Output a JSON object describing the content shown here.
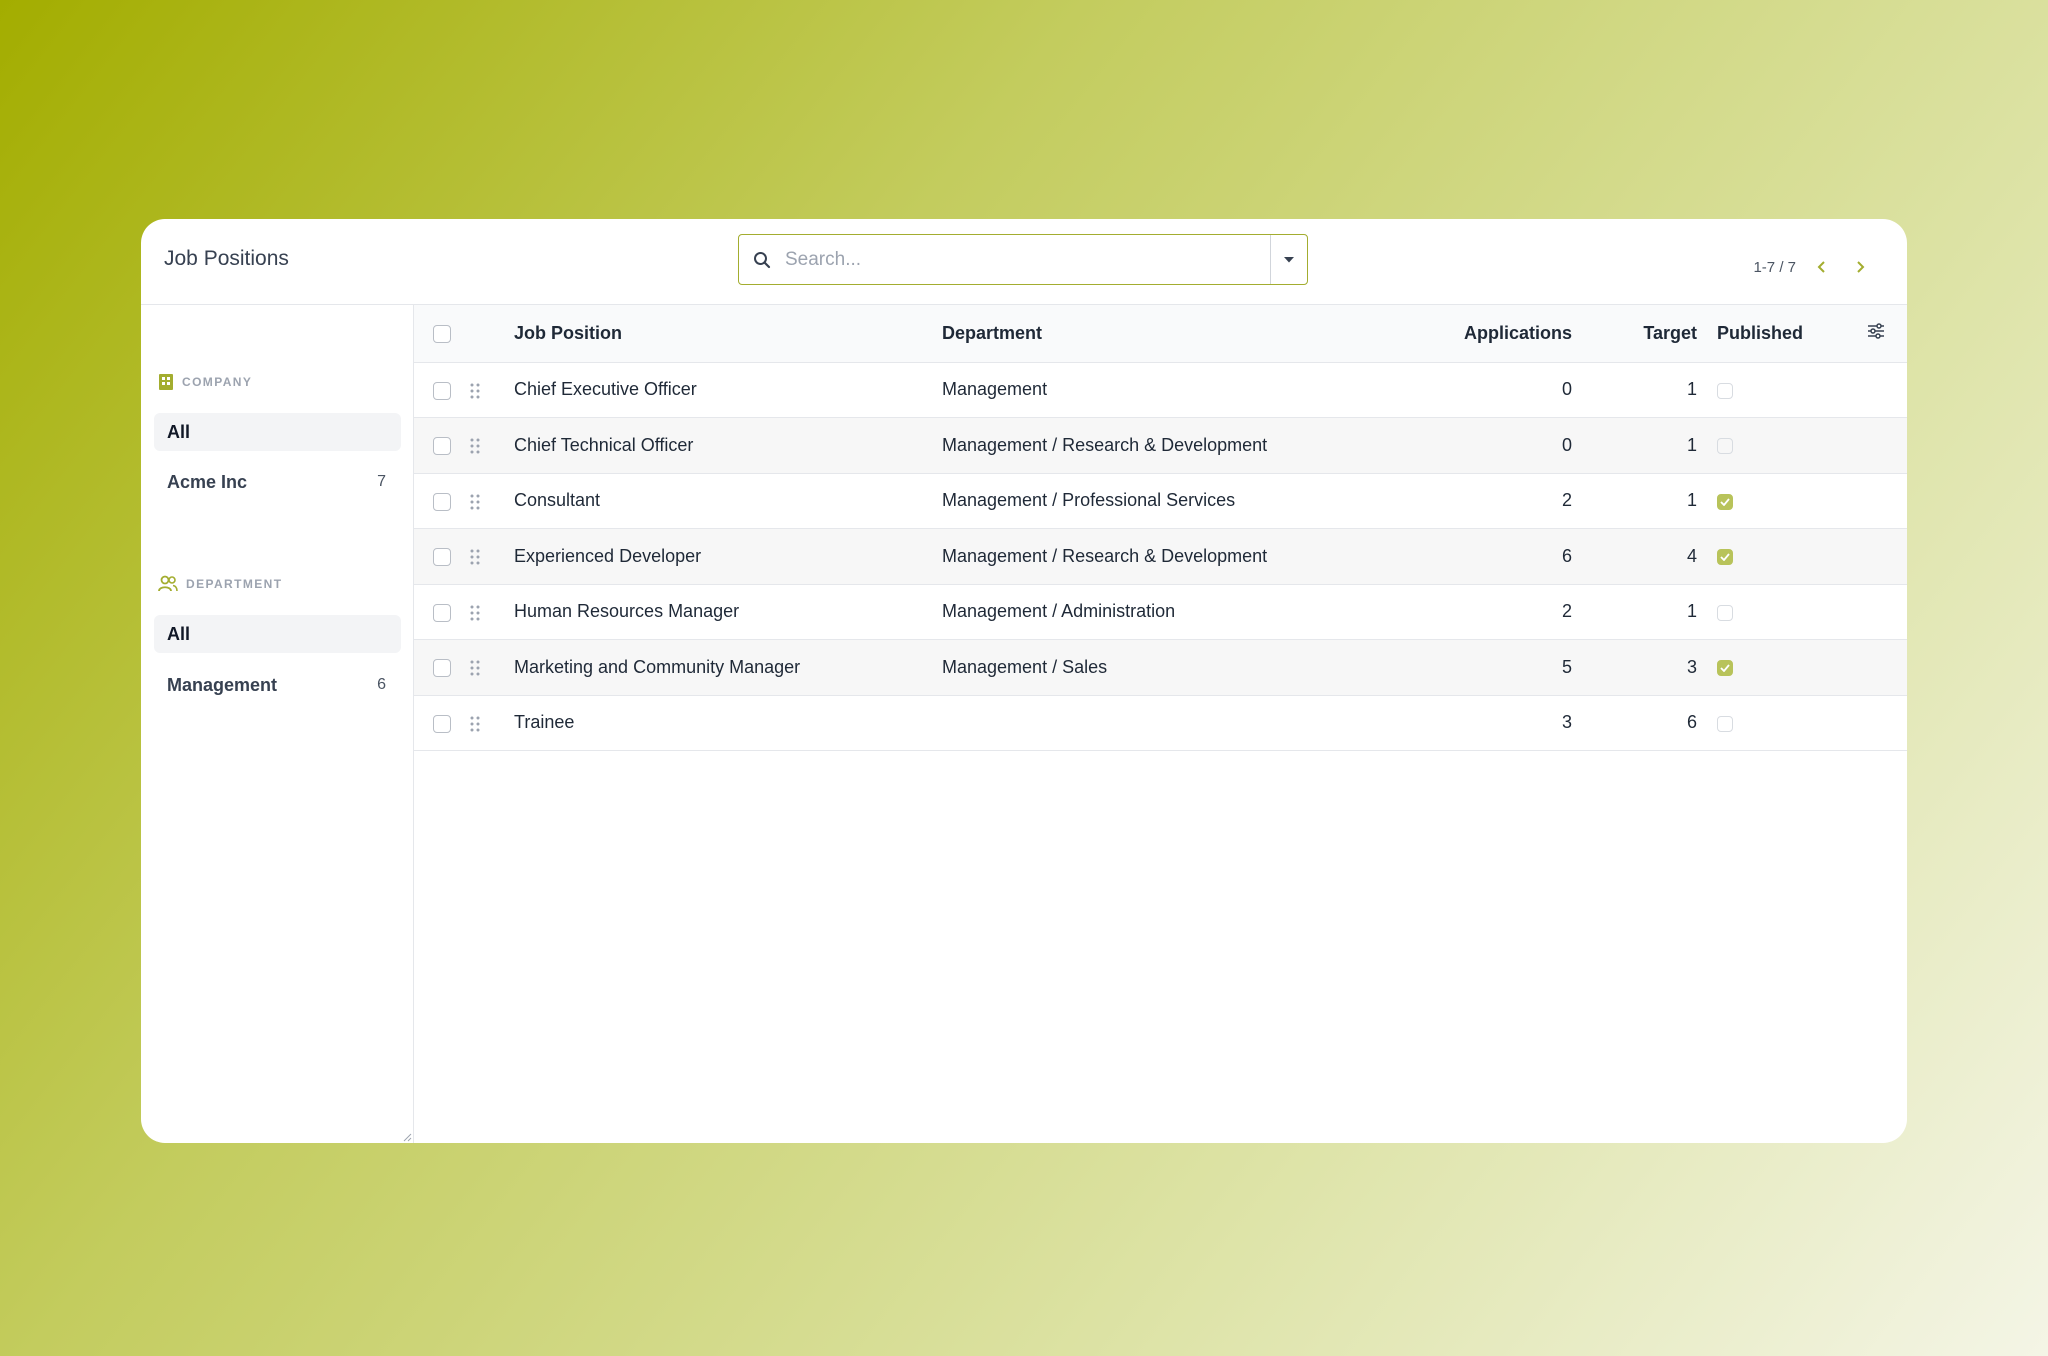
{
  "header": {
    "title": "Job Positions",
    "search_placeholder": "Search...",
    "pager": "1-7 / 7"
  },
  "sidebar": {
    "company": {
      "heading": "COMPANY",
      "items": [
        {
          "label": "All",
          "count": ""
        },
        {
          "label": "Acme Inc",
          "count": "7"
        }
      ]
    },
    "department": {
      "heading": "DEPARTMENT",
      "items": [
        {
          "label": "All",
          "count": ""
        },
        {
          "label": "Management",
          "count": "6"
        }
      ]
    }
  },
  "table": {
    "columns": {
      "position": "Job Position",
      "department": "Department",
      "applications": "Applications",
      "target": "Target",
      "published": "Published"
    },
    "rows": [
      {
        "position": "Chief Executive Officer",
        "department": "Management",
        "applications": "0",
        "target": "1",
        "published": false
      },
      {
        "position": "Chief Technical Officer",
        "department": "Management / Research & Development",
        "applications": "0",
        "target": "1",
        "published": false
      },
      {
        "position": "Consultant",
        "department": "Management / Professional Services",
        "applications": "2",
        "target": "1",
        "published": true
      },
      {
        "position": "Experienced Developer",
        "department": "Management / Research & Development",
        "applications": "6",
        "target": "4",
        "published": true
      },
      {
        "position": "Human Resources Manager",
        "department": "Management / Administration",
        "applications": "2",
        "target": "1",
        "published": false
      },
      {
        "position": "Marketing and Community Manager",
        "department": "Management / Sales",
        "applications": "5",
        "target": "3",
        "published": true
      },
      {
        "position": "Trainee",
        "department": "",
        "applications": "3",
        "target": "6",
        "published": false
      }
    ]
  },
  "colors": {
    "accent": "#a3ad2f",
    "checked": "#b8c35a"
  }
}
